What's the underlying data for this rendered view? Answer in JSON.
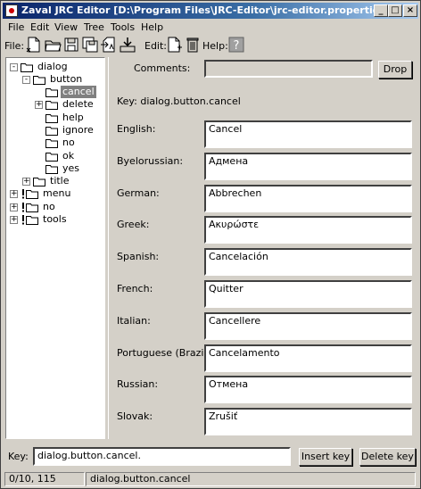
{
  "window": {
    "title": "Zaval JRC Editor [D:\\Program Files\\JRC-Editor\\jrc-editor.properties]"
  },
  "menu": {
    "items": [
      "File",
      "Edit",
      "View",
      "Tree",
      "Tools",
      "Help"
    ]
  },
  "toolbar": {
    "file_label": "File:",
    "edit_label": "Edit:",
    "help_label": "Help:"
  },
  "tree": {
    "nodes": [
      {
        "label": "dialog",
        "expander": "-"
      },
      {
        "label": "button",
        "expander": "-"
      },
      {
        "label": "cancel",
        "expander": "",
        "selected": true
      },
      {
        "label": "delete",
        "expander": "+"
      },
      {
        "label": "help",
        "expander": ""
      },
      {
        "label": "ignore",
        "expander": ""
      },
      {
        "label": "no",
        "expander": ""
      },
      {
        "label": "ok",
        "expander": ""
      },
      {
        "label": "yes",
        "expander": ""
      },
      {
        "label": "title",
        "expander": "+"
      },
      {
        "label": "menu",
        "expander": "+",
        "warning": true
      },
      {
        "label": "no",
        "expander": "+",
        "warning": true
      },
      {
        "label": "tools",
        "expander": "+",
        "warning": true
      }
    ]
  },
  "editor": {
    "comments_label": "Comments:",
    "comments_value": "",
    "drop_label": "Drop",
    "key_display": "Key: dialog.button.cancel",
    "translations": [
      {
        "language": "English:",
        "value": "Cancel"
      },
      {
        "language": "Byelorussian:",
        "value": "Адмена"
      },
      {
        "language": "German:",
        "value": "Abbrechen"
      },
      {
        "language": "Greek:",
        "value": "Ακυρώστε"
      },
      {
        "language": "Spanish:",
        "value": "Cancelación"
      },
      {
        "language": "French:",
        "value": "Quitter"
      },
      {
        "language": "Italian:",
        "value": "Cancellere"
      },
      {
        "language": "Portuguese (Brazil):",
        "value": "Cancelamento"
      },
      {
        "language": "Russian:",
        "value": "Отмена"
      },
      {
        "language": "Slovak:",
        "value": "Zrušiť"
      }
    ]
  },
  "bottom": {
    "key_label": "Key:",
    "key_value": "dialog.button.cancel.",
    "insert_label": "Insert key",
    "delete_label": "Delete key"
  },
  "status": {
    "position": "0/10, 115",
    "key": "dialog.button.cancel"
  },
  "colors": {
    "title_start": "#0a246a",
    "title_end": "#a6caf0",
    "selection": "#808080",
    "face": "#d4d0c8"
  }
}
